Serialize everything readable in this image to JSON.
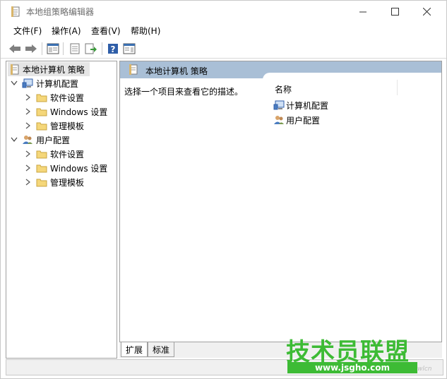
{
  "window": {
    "title": "本地组策略编辑器",
    "controls": {
      "minimize": "—",
      "maximize": "☐",
      "close": "✕"
    }
  },
  "menu": [
    {
      "label": "文件(F)"
    },
    {
      "label": "操作(A)"
    },
    {
      "label": "查看(V)"
    },
    {
      "label": "帮助(H)"
    }
  ],
  "toolbar": {
    "icons": [
      "back-arrow-icon",
      "forward-arrow-icon",
      "show-hide-console-tree-icon",
      "properties-icon",
      "export-list-icon",
      "help-icon",
      "show-hide-action-pane-icon"
    ]
  },
  "tree": {
    "root": "本地计算机 策略",
    "computer": {
      "label": "计算机配置",
      "children": [
        "软件设置",
        "Windows 设置",
        "管理模板"
      ]
    },
    "user": {
      "label": "用户配置",
      "children": [
        "软件设置",
        "Windows 设置",
        "管理模板"
      ]
    }
  },
  "details": {
    "header_title": "本地计算机 策略",
    "description": "选择一个项目来查看它的描述。",
    "column_name": "名称",
    "items": [
      "计算机配置",
      "用户配置"
    ]
  },
  "tabs": [
    "扩展",
    "标准"
  ],
  "watermark": {
    "title": "技术员联盟",
    "url": "www.jsgho.com",
    "tag": "wlcn"
  },
  "colors": {
    "header_bg": "#a9bfd6",
    "watermark_green": "#3dbb35"
  }
}
